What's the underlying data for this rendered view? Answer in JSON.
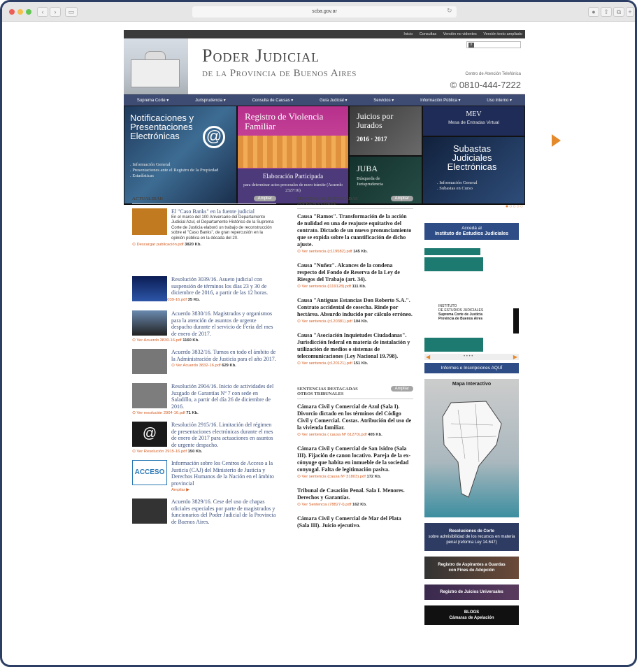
{
  "browser": {
    "url": "scba.gov.ar",
    "traffic_colors": [
      "#ec5f57",
      "#f4bf4f",
      "#62c655"
    ]
  },
  "topbar": {
    "links": [
      "Inicio",
      "Consultas",
      "Versión no videntes",
      "Versión texto ampliado"
    ]
  },
  "header": {
    "title": "Poder Judicial",
    "subtitle": "de la Provincia de Buenos Aires",
    "call_center_label": "Centro de Atención Telefónica",
    "phone": "© 0810-444-7222"
  },
  "menu": {
    "items": [
      "Suprema Corte",
      "Jurisprudencia",
      "Consulta de Causas",
      "Guía Judicial",
      "Servicios",
      "Información Pública",
      "Uso Interno"
    ]
  },
  "banners": {
    "notif_title": "Notificaciones y Presentaciones Electrónicas",
    "notif_links": [
      ". Información General",
      ". Presentaciones ante el Registro de la Propiedad",
      ". Estadísticas"
    ],
    "registro_title": "Registro de Violencia Familiar",
    "elab_title": "Elaboración Participada",
    "elab_sub": "para determinar actos procesales de mero trámite (Acuerdo 2327/16)",
    "juicios_title": "Juicios por Jurados",
    "juicios_years": "2016 · 2017",
    "juba_title": "JUBA",
    "juba_sub": "Búsqueda de Jurisprudencia",
    "mev_title": "MEV",
    "mev_sub": "Mesa de Entradas Virtual",
    "subastas_title": "Subastas Judiciales Electrónicas",
    "subastas_links": [
      ". Información General",
      ". Subastas en Curso"
    ],
    "pager": "●○○○○"
  },
  "actualidad": {
    "heading": "ACTUALIDAD",
    "more": "Ampliar",
    "items": [
      {
        "title": "El \"Caso Banks\" en la fuente judicial",
        "body": "En el marco del 100 Aniversario del Departamento Judicial Azul, el Departamento Histórico de la Suprema Corte de Justicia elaboró un trabajo de reconstrucción sobre el \"Caso Banks\", de gran repercusión en la opinión pública en la década del 20.",
        "link": "Descargar publicación.pdf",
        "size": "3820 Kb."
      },
      {
        "title": "Resolución 3039/16. Asueto judicial con suspensión de términos los días 23 y 30 de diciembre de 2016, a partir de las 12 horas.",
        "body": "",
        "link": "Ver Resolución 3039-16.pdf",
        "size": "35 Kb."
      },
      {
        "title": "Acuerdo 3830/16. Magistrados y organismos para la atención de asuntos de urgente despacho durante el servicio de Feria del mes de enero de 2017.",
        "body": "",
        "link": "Ver Acuerdo 3830-16.pdf",
        "size": "1160 Kb."
      },
      {
        "title": "Acuerdo 3832/16. Turnos en todo el ámbito de la Administración de Justicia para el año 2017.",
        "body": "",
        "link": "Ver Acuerdo 3832-16.pdf",
        "size": "629 Kb."
      },
      {
        "title": "Resolución 2904/16. Inicio de actividades del Juzgado de Garantías Nº 7 con sede en Saladillo, a partir del día 26 de diciembre de 2016.",
        "body": "",
        "link": "Ver resolución 2904-16.pdf",
        "size": "71 Kb."
      },
      {
        "title": "Resolución 2915/16. Limitación del régimen de presentaciones electrónicas durante el mes de enero de 2017 para actuaciones en asuntos de urgente despacho.",
        "body": "",
        "link": "Ver Resolución 2915-16.pdf",
        "size": "150 Kb."
      },
      {
        "title": "Información sobre los Centros de Acceso a la Justicia (CAJ) del Ministerio de Justicia y Derechos Humanos de la Nación en el ámbito provincial",
        "body": "",
        "link": "Ampliar ▶",
        "size": ""
      },
      {
        "title": "Acuerdo 3829/16. Cese del uso de chapas oficiales especiales por parte de magistrados y funcionarios del Poder Judicial de la Provincia de Buenos Aires.",
        "body": "",
        "link": "",
        "size": ""
      }
    ]
  },
  "sentencias_corte": {
    "heading": "SENTENCIAS DESTACADAS SUPREMA CORTE",
    "more": "Ampliar",
    "items": [
      {
        "title": "Causa \"Ramos\". Transformación de la acción de nulidad en una de reajuste equitativo del contrato. Dictado de un nuevo pronunciamiento que se expida sobre la cuantificación de dicho ajuste.",
        "link": "Ver sentencia (c119582).pdf",
        "size": "145 Kb."
      },
      {
        "title": "Causa \"Nuñez\". Alcances de la condena respecto del Fondo de Reserva de la Ley de Riesgos del Trabajo (art. 34).",
        "link": "Ver sentencia (l119128).pdf",
        "size": "111 Kb."
      },
      {
        "title": "Causa \"Antiguas Estancias Don Roberto S.A.\". Contrato accidental de cosecha. Rinde por hectárea. Absurdo inducido por cálculo erróneo.",
        "link": "Ver sentencia (c120381).pdf",
        "size": "104 Kb."
      },
      {
        "title": "Causa \"Asociación Inquietudes Ciudadanas\". Jurisdicción federal en materia de instalación y utilización de medios o sistemas de telecomunicaciones (Ley Nacional 19.798).",
        "link": "Ver sentencia (c120121).pdf",
        "size": "151 Kb."
      }
    ]
  },
  "sentencias_otros": {
    "heading": "SENTENCIAS DESTACADAS OTROS TRIBUNALES",
    "more": "Ampliar",
    "items": [
      {
        "title": "Cámara Civil y Comercial de Azul (Sala I). Divorcio dictado en los términos del Código Civil y Comercial. Costas. Atribución del uso de la vivienda familiar.",
        "link": "Ver sentencia ( causa Nº 61270).pdf",
        "size": "405 Kb."
      },
      {
        "title": "Cámara Civil y Comercial de San Isidro (Sala III). Fijación de canon locativo. Pareja de la ex-cónyuge que habita en inmueble de la sociedad conyugal. Falta de legitimación pasiva.",
        "link": "Ver sentencia (causa Nº 31803).pdf",
        "size": "172 Kb."
      },
      {
        "title": "Tribunal de Casación Penal. Sala I. Menores. Derechos y Garantías.",
        "link": "Ver Sentencia (78827-I).pdf",
        "size": "162 Kb."
      },
      {
        "title": "Cámara Civil y Comercial de Mar del Plata (Sala III). Juicio ejecutivo.",
        "link": "",
        "size": ""
      }
    ]
  },
  "sidebar": {
    "instituto_access": "Accedá al",
    "instituto_name": "Instituto de Estudios Judiciales",
    "instituto_logo_1": "INSTITUTO",
    "instituto_logo_2": "DE ESTUDIOS JUDICIALES",
    "instituto_logo_3": "Suprema Corte de Justicia",
    "instituto_logo_4": "Provincia de Buenos Aires",
    "carousel_dots": "• • • •",
    "informes": "Informes e Inscripciones AQUÍ",
    "mapa": "Mapa Interactivo",
    "res_corte_title": "Resoluciones de Corte",
    "res_corte_body": "sobre admisibilidad de los recursos en materia penal (reforma Ley 14.647)",
    "registro_aspirantes": "Registro de Aspirantes a Guardas con Fines de Adopción",
    "registro_juicios": "Registro de Juicios Universales",
    "blogs_title": "BLOGS",
    "blogs_sub": "Cámaras de Apelación"
  }
}
